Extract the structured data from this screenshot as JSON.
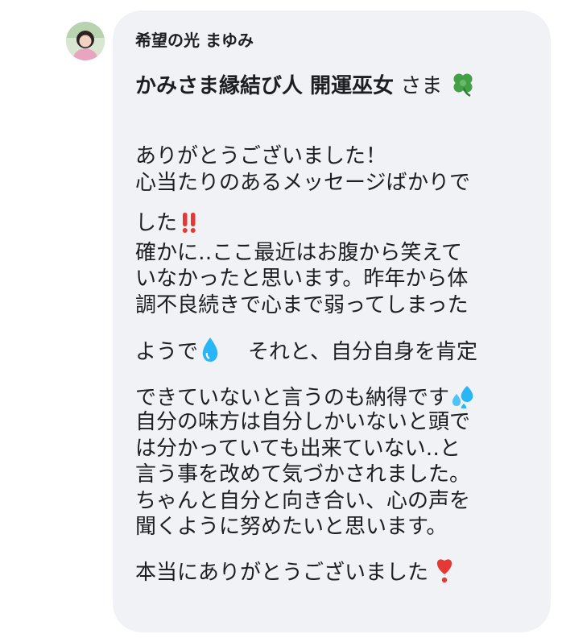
{
  "comment": {
    "sender_name": "希望の光 まゆみ",
    "mention": "かみさま縁結び人 開運巫女",
    "salutation": "さま",
    "lines": [
      "ありがとうございました！",
      "心当たりのあるメッセージばかりで",
      "した",
      "確かに‥ここ最近はお腹から笑えて",
      "いなかったと思います。昨年から体",
      "調不良続きで心まで弱ってしまった",
      "ようで",
      "それと、自分自身を肯定",
      "できていないと言うのも納得です",
      "自分の味方は自分しかいないと頭で",
      "は分かっていても出来ていない‥と",
      "言う事を改めて気づかされました。",
      "ちゃんと自分と向き合い、心の声を",
      "聞くように努めたいと思います。",
      "本当にありがとうございました"
    ],
    "emojis": {
      "clover": "four-leaf-clover-icon",
      "double_exclamation": "double-exclamation-icon",
      "droplet": "droplet-icon",
      "sweat_drops": "sweat-droplets-icon",
      "heavy_exclamation": "heart-exclamation-icon"
    }
  },
  "colors": {
    "bubble": "#f0f2f5",
    "text": "#1c1e21",
    "clover": "#4caf50",
    "exclamation": "#e53935",
    "droplet": "#29b6f6"
  }
}
